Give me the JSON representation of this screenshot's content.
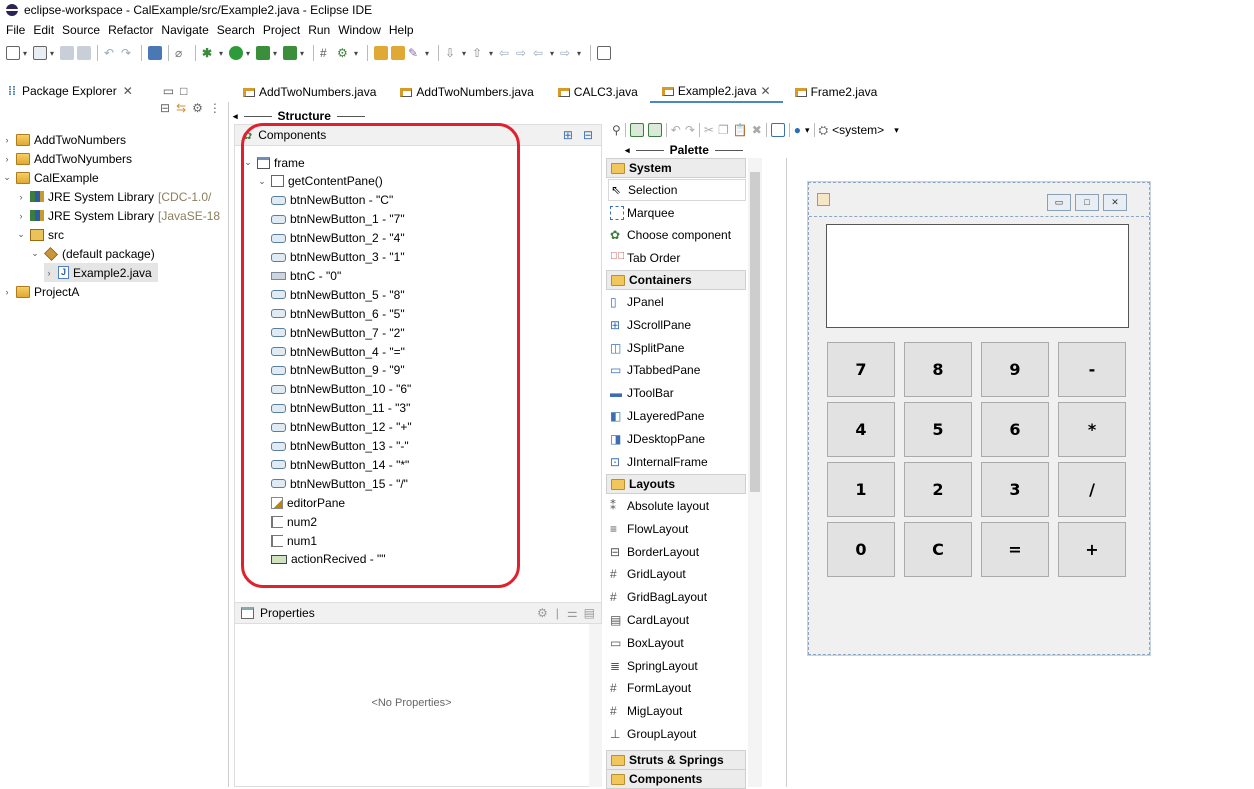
{
  "window": {
    "title": "eclipse-workspace - CalExample/src/Example2.java - Eclipse IDE"
  },
  "menu": [
    "File",
    "Edit",
    "Source",
    "Refactor",
    "Navigate",
    "Search",
    "Project",
    "Run",
    "Window",
    "Help"
  ],
  "package_explorer": {
    "tab_label": "Package Explorer",
    "tree": [
      {
        "label": "AddTwoNumbers"
      },
      {
        "label": "AddTwoNyumbers"
      },
      {
        "label": "CalExample"
      },
      {
        "label": "JRE System Library",
        "suffix": "[CDC-1.0/"
      },
      {
        "label": "JRE System Library",
        "suffix": "[JavaSE-18"
      },
      {
        "label": "src"
      },
      {
        "label": "(default package)"
      },
      {
        "label": "Example2.java"
      },
      {
        "label": "ProjectA"
      }
    ]
  },
  "editor_tabs": [
    {
      "label": "AddTwoNumbers.java"
    },
    {
      "label": "AddTwoNumbers.java"
    },
    {
      "label": "CALC3.java"
    },
    {
      "label": "Example2.java",
      "active": true
    },
    {
      "label": "Frame2.java"
    }
  ],
  "structure": {
    "title": "Structure",
    "components_label": "Components",
    "tree": [
      "frame",
      "getContentPane()",
      "btnNewButton - \"C\"",
      "btnNewButton_1 - \"7\"",
      "btnNewButton_2 - \"4\"",
      "btnNewButton_3 - \"1\"",
      "btnC - \"0\"",
      "btnNewButton_5 - \"8\"",
      "btnNewButton_6 - \"5\"",
      "btnNewButton_7 - \"2\"",
      "btnNewButton_4 - \"=\"",
      "btnNewButton_9 - \"9\"",
      "btnNewButton_10 - \"6\"",
      "btnNewButton_11 - \"3\"",
      "btnNewButton_12 - \"+\"",
      "btnNewButton_13 - \"-\"",
      "btnNewButton_14 - \"*\"",
      "btnNewButton_15 - \"/\"",
      "editorPane",
      "num2",
      "num1",
      "actionRecived - \"\""
    ]
  },
  "properties": {
    "title": "Properties",
    "empty_text": "<No Properties>"
  },
  "designer_toolbar": {
    "system_label": "<system>"
  },
  "palette": {
    "title": "Palette",
    "categories": {
      "system": "System",
      "containers": "Containers",
      "layouts": "Layouts",
      "struts": "Struts & Springs",
      "components": "Components"
    },
    "system_items": [
      "Selection",
      "Marquee",
      "Choose component",
      "Tab Order"
    ],
    "container_items": [
      "JPanel",
      "JScrollPane",
      "JSplitPane",
      "JTabbedPane",
      "JToolBar",
      "JLayeredPane",
      "JDesktopPane",
      "JInternalFrame"
    ],
    "layout_items": [
      "Absolute layout",
      "FlowLayout",
      "BorderLayout",
      "GridLayout",
      "GridBagLayout",
      "CardLayout",
      "BoxLayout",
      "SpringLayout",
      "FormLayout",
      "MigLayout",
      "GroupLayout"
    ]
  },
  "calculator": {
    "keys": [
      "7",
      "8",
      "9",
      "-",
      "4",
      "5",
      "6",
      "*",
      "1",
      "2",
      "3",
      "/",
      "0",
      "C",
      "=",
      "+"
    ]
  },
  "colors": {
    "highlight": "#e0202c",
    "active_tab": "#4a86c8"
  }
}
